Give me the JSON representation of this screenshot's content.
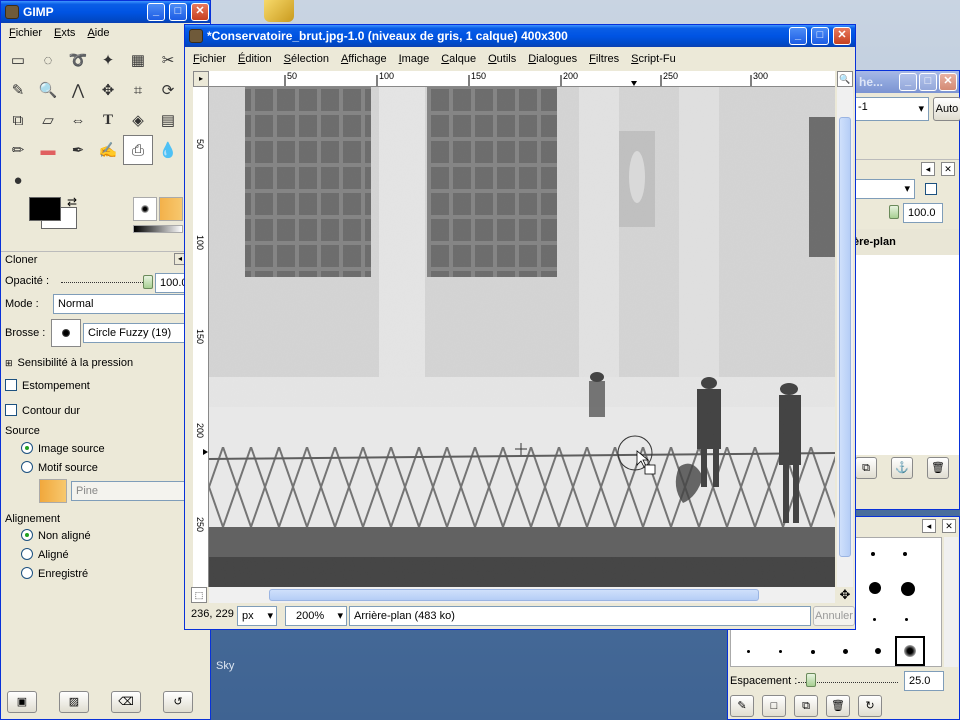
{
  "toolbox": {
    "title": "GIMP",
    "menus": [
      "Fichier",
      "Exts",
      "Aide"
    ],
    "tool_options_title": "Cloner",
    "opacity_label": "Opacité :",
    "opacity_value": "100.0",
    "mode_label": "Mode :",
    "mode_value": "Normal",
    "brush_label": "Brosse :",
    "brush_value": "Circle Fuzzy (19)",
    "pressure_label": "Sensibilité à la pression",
    "fade_label": "Estompement",
    "hard_edge_label": "Contour dur",
    "source_label": "Source",
    "source_image": "Image source",
    "source_pattern": "Motif source",
    "pattern_name": "Pine",
    "alignment_label": "Alignement",
    "align_none": "Non aligné",
    "align_aligned": "Aligné",
    "align_registered": "Enregistré"
  },
  "image_window": {
    "title": "*Conservatoire_brut.jpg-1.0 (niveaux de gris, 1 calque) 400x300",
    "menus": [
      "Fichier",
      "Édition",
      "Sélection",
      "Affichage",
      "Image",
      "Calque",
      "Outils",
      "Dialogues",
      "Filtres",
      "Script-Fu"
    ],
    "ruler_h": [
      "50",
      "100",
      "150",
      "200",
      "250",
      "300"
    ],
    "ruler_v": [
      "50",
      "100",
      "150",
      "200",
      "250"
    ],
    "coords": "236, 229",
    "unit": "px",
    "zoom": "200%",
    "layer_status": "Arrière-plan (483 ko)",
    "cancel": "Annuler"
  },
  "dock1": {
    "title": "he...",
    "field_value": "-1",
    "auto_button": "Auto",
    "opacity_value": "100.0",
    "layer_name": "ère-plan"
  },
  "dock2": {
    "spacing_label": "Espacement :",
    "spacing_value": "25.0"
  },
  "desktop": {
    "label": "Sky"
  },
  "colors": {
    "xp_title_blue": "#0054e3",
    "window_bg": "#ece9d8",
    "accent_pattern": "#f3b14a"
  }
}
